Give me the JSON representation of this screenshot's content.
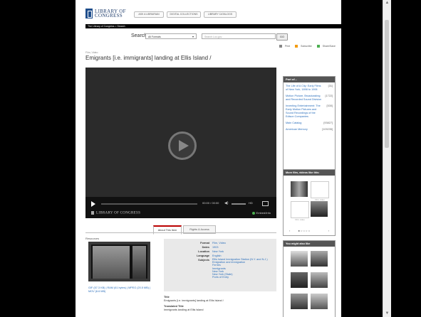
{
  "logo": {
    "line1": "LIBRARY OF",
    "line2": "CONGRESS"
  },
  "top_buttons": [
    "ASK A LIBRARIAN",
    "DIGITAL COLLECTIONS",
    "LIBRARY CATALOGS"
  ],
  "breadcrumb": "The Library of Congress > Search",
  "search": {
    "label": "Search",
    "format": "All Formats",
    "placeholder": "Search Loc.gov",
    "go": "GO"
  },
  "utility": {
    "print": "Print",
    "subscribe": "Subscribe",
    "share": "Share/Save"
  },
  "item": {
    "format": "Film, Video",
    "title": "Emigrants [i.e. immigrants] landing at Ellis Island /"
  },
  "player": {
    "time": "00:00 / 00:00",
    "hd": "HD",
    "logo": "LIBRARY OF CONGRESS",
    "embed": "Embed/Info"
  },
  "part_of": {
    "heading": "Part of...",
    "items": [
      {
        "label": "The Life of A City: Early Films of New York, 1898 to 1906",
        "count": "[31]"
      },
      {
        "label": "Motion Picture, Broadcasting and Recorded Sound Division",
        "count": "[1722]"
      },
      {
        "label": "Inventing Entertainment: The Early Motion Pictures and Sound Recordings of the Edison Companies",
        "count": "[530]"
      },
      {
        "label": "Main Catalog",
        "count": "[93827]"
      },
      {
        "label": "American Memory",
        "count": "[109235]"
      }
    ]
  },
  "more_box": {
    "heading": "More film, videos like this:",
    "no_video": "Film: video"
  },
  "pager": {
    "prev": "‹",
    "next": "›"
  },
  "you_might_like": {
    "heading": "You might also like"
  },
  "tabs": [
    "About This Item",
    "Rights & Access"
  ],
  "resources": {
    "label": "Resources",
    "links": "GIF (57.3 KB) | RAM (61 bytes) | MPEG (20.5 MB) | MOV (6.6 MB)"
  },
  "metadata": {
    "format_k": "Format",
    "format_v": "Film, Video",
    "dates_k": "Dates",
    "dates_v": "1903",
    "location_k": "Location",
    "location_v": "New York",
    "language_k": "Language",
    "language_v": "English",
    "subjects_k": "Subjects",
    "subjects": [
      "Ellis Island Immigration Station (N.Y. and N.J.)",
      "Emigration and immigration",
      "Ferries",
      "Immigrants",
      "New York",
      "New York (State)",
      "Ports of Entry"
    ]
  },
  "details": {
    "title_label": "Title",
    "title_value": "Emigrants [i.e. immigrants] landing at Ellis Island /",
    "translated_label": "Translated Title",
    "translated_value": "Immigrants landing at Ellis Island"
  }
}
